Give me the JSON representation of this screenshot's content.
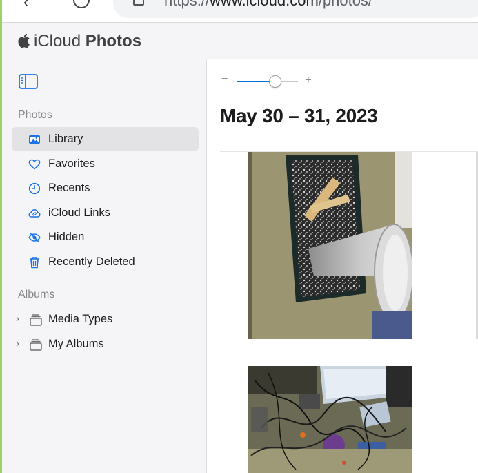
{
  "browser": {
    "url_prefix": "https://",
    "url_host": "www.icloud.com",
    "url_path": "/photos/"
  },
  "header": {
    "app_name_light": "iCloud",
    "app_name_bold": "Photos"
  },
  "sidebar": {
    "photos_section": "Photos",
    "items": [
      {
        "label": "Library",
        "icon": "library-icon",
        "selected": true
      },
      {
        "label": "Favorites",
        "icon": "heart-icon",
        "selected": false
      },
      {
        "label": "Recents",
        "icon": "clock-icon",
        "selected": false
      },
      {
        "label": "iCloud Links",
        "icon": "cloud-link-icon",
        "selected": false
      },
      {
        "label": "Hidden",
        "icon": "eye-slash-icon",
        "selected": false
      },
      {
        "label": "Recently Deleted",
        "icon": "trash-icon",
        "selected": false
      }
    ],
    "albums_section": "Albums",
    "albums": [
      {
        "label": "Media Types",
        "icon": "album-stack-icon"
      },
      {
        "label": "My Albums",
        "icon": "album-stack-icon"
      }
    ]
  },
  "main": {
    "zoom": {
      "minus": "−",
      "plus": "+",
      "level": 0.62
    },
    "date_heading": "May 30 – 31, 2023",
    "photos": [
      {
        "description": "wafer-and-cup-on-mat-photo"
      },
      {
        "description": "cluttered-desk-with-cables-photo"
      }
    ]
  },
  "colors": {
    "accent": "#0071e3",
    "sidebar_bg": "#f5f5f7",
    "selected_bg": "#e3e3e6",
    "icon_blue": "#1a73e8"
  }
}
